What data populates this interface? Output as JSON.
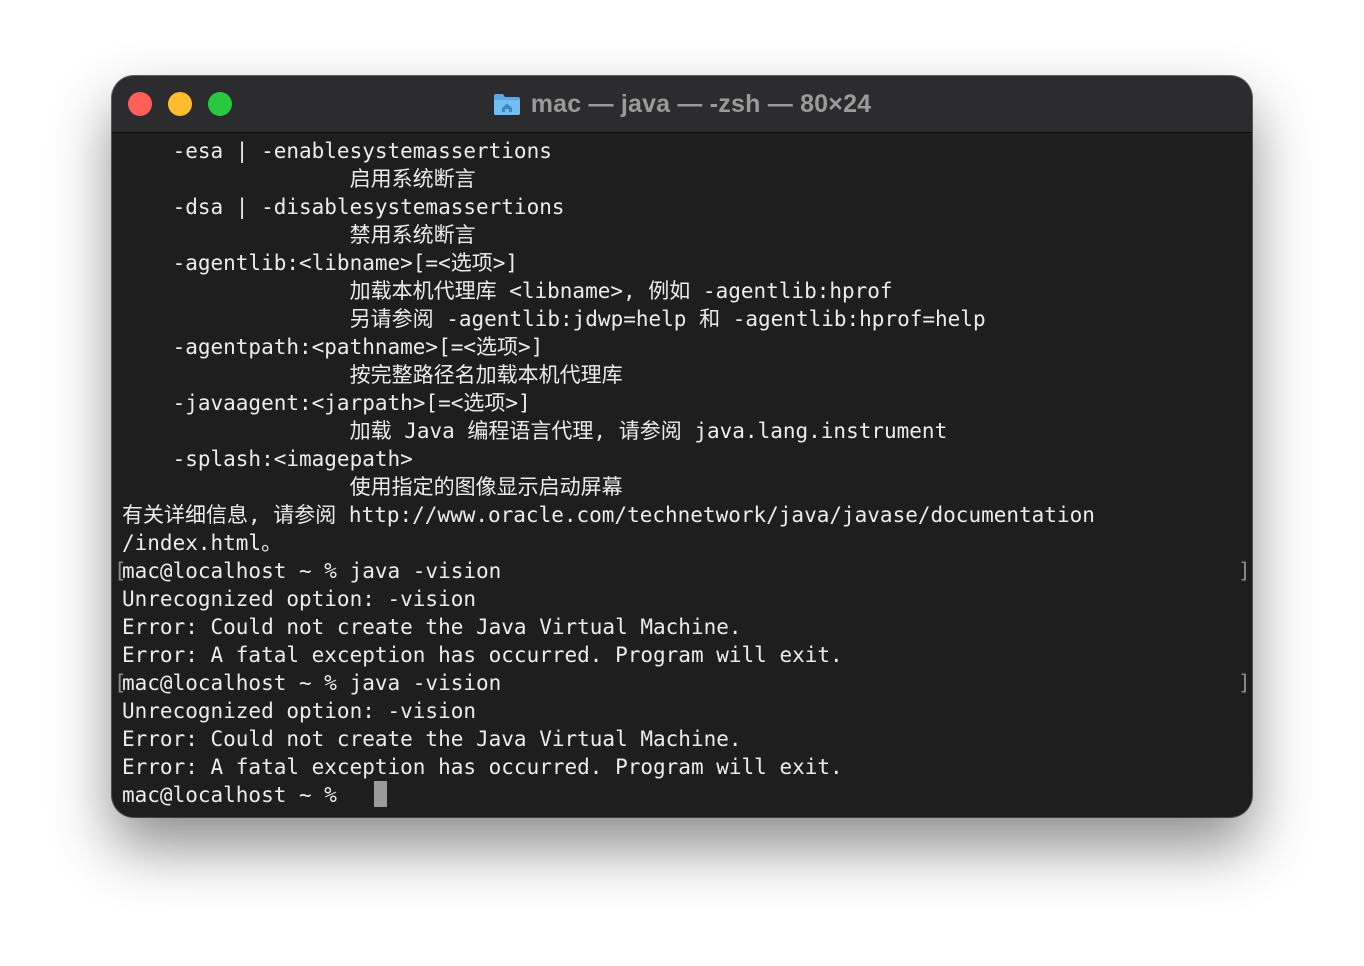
{
  "window": {
    "title": "mac — java — -zsh — 80×24",
    "title_icon": "home-folder-icon"
  },
  "terminal": {
    "lines": [
      "    -esa | -enablesystemassertions",
      "                  启用系统断言",
      "    -dsa | -disablesystemassertions",
      "                  禁用系统断言",
      "    -agentlib:<libname>[=<选项>]",
      "                  加载本机代理库 <libname>, 例如 -agentlib:hprof",
      "                  另请参阅 -agentlib:jdwp=help 和 -agentlib:hprof=help",
      "    -agentpath:<pathname>[=<选项>]",
      "                  按完整路径名加载本机代理库",
      "    -javaagent:<jarpath>[=<选项>]",
      "                  加载 Java 编程语言代理, 请参阅 java.lang.instrument",
      "    -splash:<imagepath>",
      "                  使用指定的图像显示启动屏幕",
      "有关详细信息, 请参阅 http://www.oracle.com/technetwork/java/javase/documentation",
      "/index.html。",
      "mac@localhost ~ % java -vision",
      "Unrecognized option: -vision",
      "Error: Could not create the Java Virtual Machine.",
      "Error: A fatal exception has occurred. Program will exit.",
      "mac@localhost ~ % java -vision",
      "Unrecognized option: -vision",
      "Error: Could not create the Java Virtual Machine.",
      "Error: A fatal exception has occurred. Program will exit.",
      "mac@localhost ~ % "
    ],
    "bracket_left": "[",
    "bracket_right": "]"
  },
  "colors": {
    "background": "#1e1e1e",
    "titlebar": "#2c2c2e",
    "text": "#ececec",
    "close": "#ff5f57",
    "minimize": "#febc2e",
    "zoom": "#28c840"
  }
}
